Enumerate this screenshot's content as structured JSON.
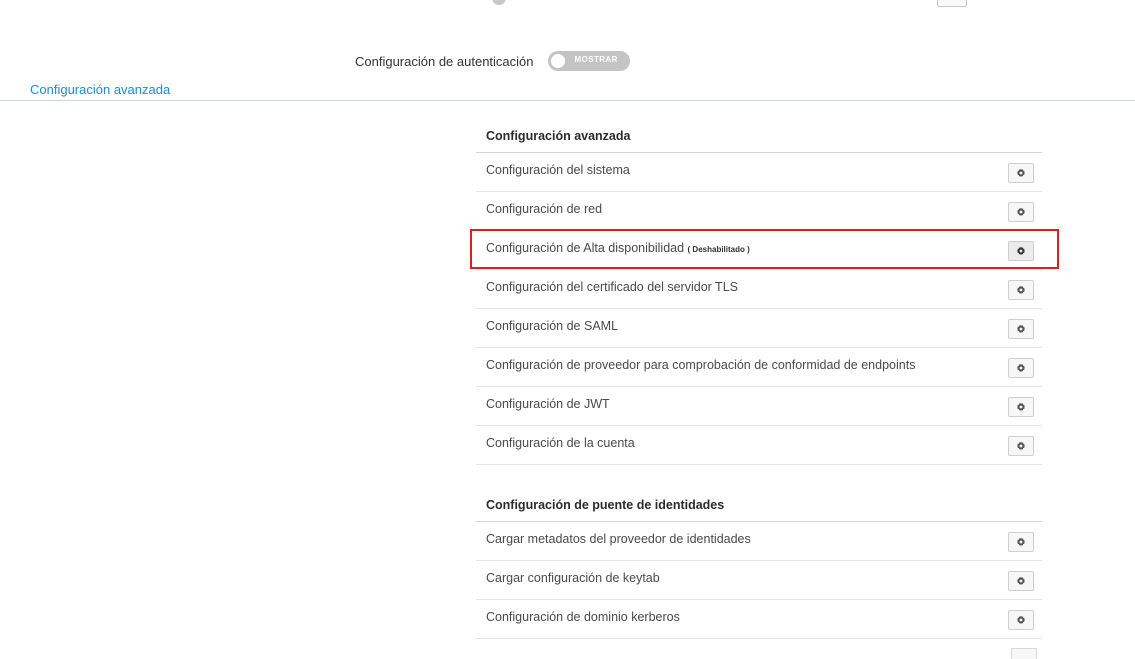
{
  "auth": {
    "label": "Configuración de autenticación",
    "toggle_text": "MOSTRAR"
  },
  "advanced_link": "Configuración avanzada",
  "groups": [
    {
      "title": "Configuración avanzada",
      "items": [
        {
          "label": "Configuración del sistema"
        },
        {
          "label": "Configuración de red"
        },
        {
          "label": "Configuración de Alta disponibilidad",
          "sub": "( Deshabilitado )",
          "highlighted": true
        },
        {
          "label": "Configuración del certificado del servidor TLS"
        },
        {
          "label": "Configuración de SAML"
        },
        {
          "label": "Configuración de proveedor para comprobación de conformidad de endpoints"
        },
        {
          "label": "Configuración de JWT"
        },
        {
          "label": "Configuración de la cuenta"
        }
      ]
    },
    {
      "title": "Configuración de puente de identidades",
      "items": [
        {
          "label": "Cargar metadatos del proveedor de identidades"
        },
        {
          "label": "Cargar configuración de keytab"
        },
        {
          "label": "Configuración de dominio kerberos"
        }
      ]
    }
  ],
  "icons": {
    "settings": "gear-icon"
  },
  "colors": {
    "link": "#1a8cd8",
    "highlight": "#e01e1e",
    "toggle_off": "#c4c4c4"
  }
}
